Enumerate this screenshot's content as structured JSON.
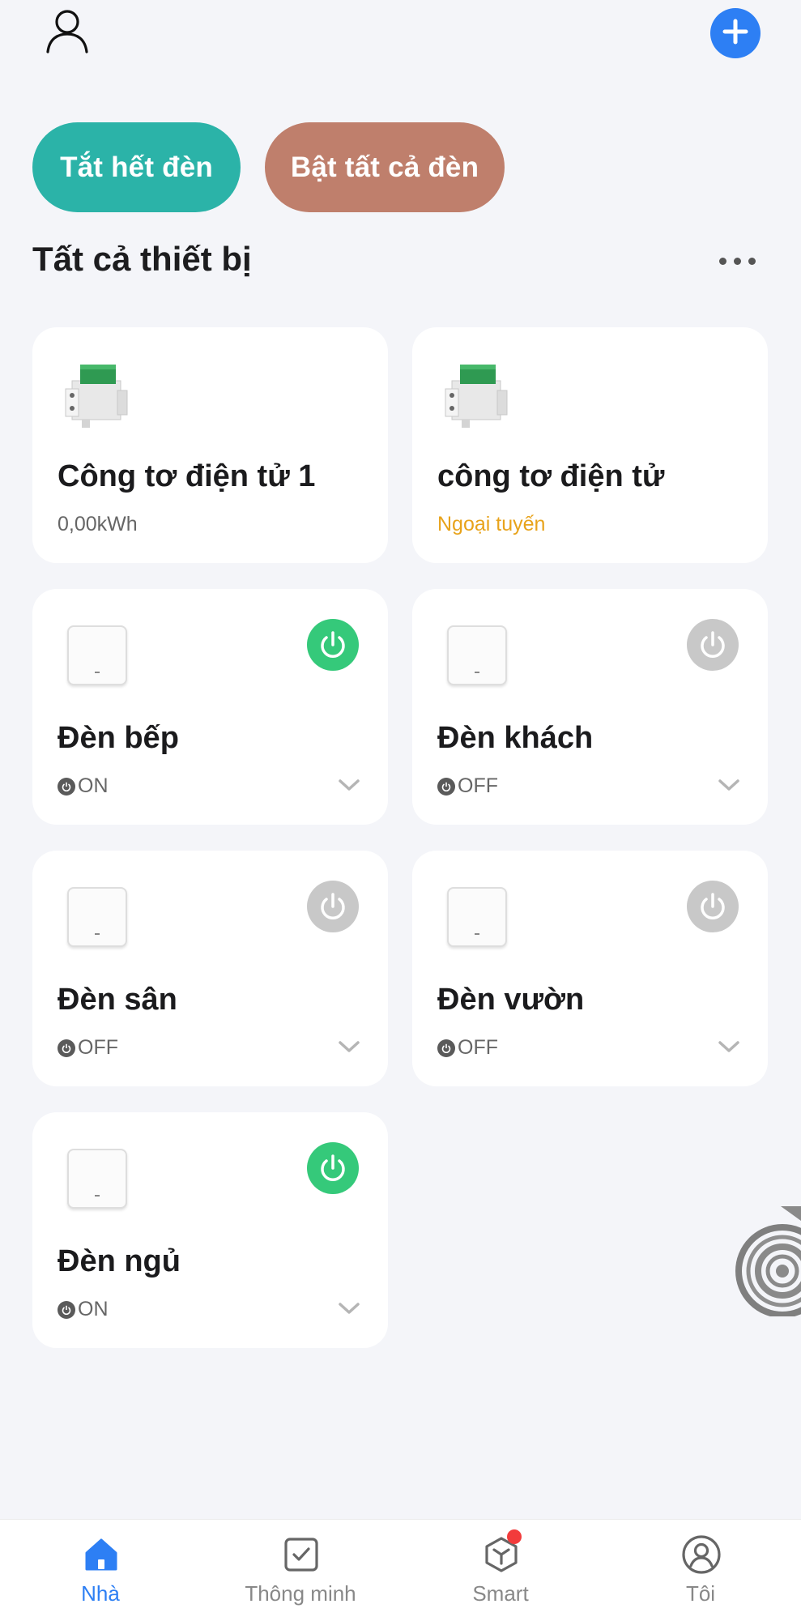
{
  "header": {
    "profile_icon": "user-icon",
    "add_icon": "plus-icon"
  },
  "actions": {
    "turn_off_all": "Tắt hết đèn",
    "turn_on_all": "Bật tất cả đèn"
  },
  "section": {
    "title": "Tất cả thiết bị",
    "more_icon": "more-horizontal-icon"
  },
  "devices": [
    {
      "name": "Công tơ điện tử 1",
      "status": "0,00kWh",
      "type": "energy-meter"
    },
    {
      "name": "công tơ điện tử",
      "status": "Ngoại tuyến",
      "type": "energy-meter"
    },
    {
      "name": "Đèn bếp",
      "status": "ON",
      "type": "switch",
      "power": "on"
    },
    {
      "name": "Đèn khách",
      "status": "OFF",
      "type": "switch",
      "power": "off"
    },
    {
      "name": "Đèn sân",
      "status": "OFF",
      "type": "switch",
      "power": "off"
    },
    {
      "name": "Đèn vườn",
      "status": "OFF",
      "type": "switch",
      "power": "off"
    },
    {
      "name": "Đèn ngủ",
      "status": "ON",
      "type": "switch",
      "power": "on"
    }
  ],
  "bottom_nav": [
    {
      "label": "Nhà",
      "icon": "home-icon",
      "active": true
    },
    {
      "label": "Thông minh",
      "icon": "checkbox-icon",
      "active": false
    },
    {
      "label": "Smart",
      "icon": "cube-icon",
      "active": false
    },
    {
      "label": "Tôi",
      "icon": "user-circle-icon",
      "active": false
    }
  ],
  "colors": {
    "accent": "#2d7ff4",
    "off_button": "#2bb3a8",
    "on_button": "#bf7f6c",
    "power_on": "#35c97a",
    "power_off": "#c8c8c8",
    "offline": "#e8a31b"
  }
}
